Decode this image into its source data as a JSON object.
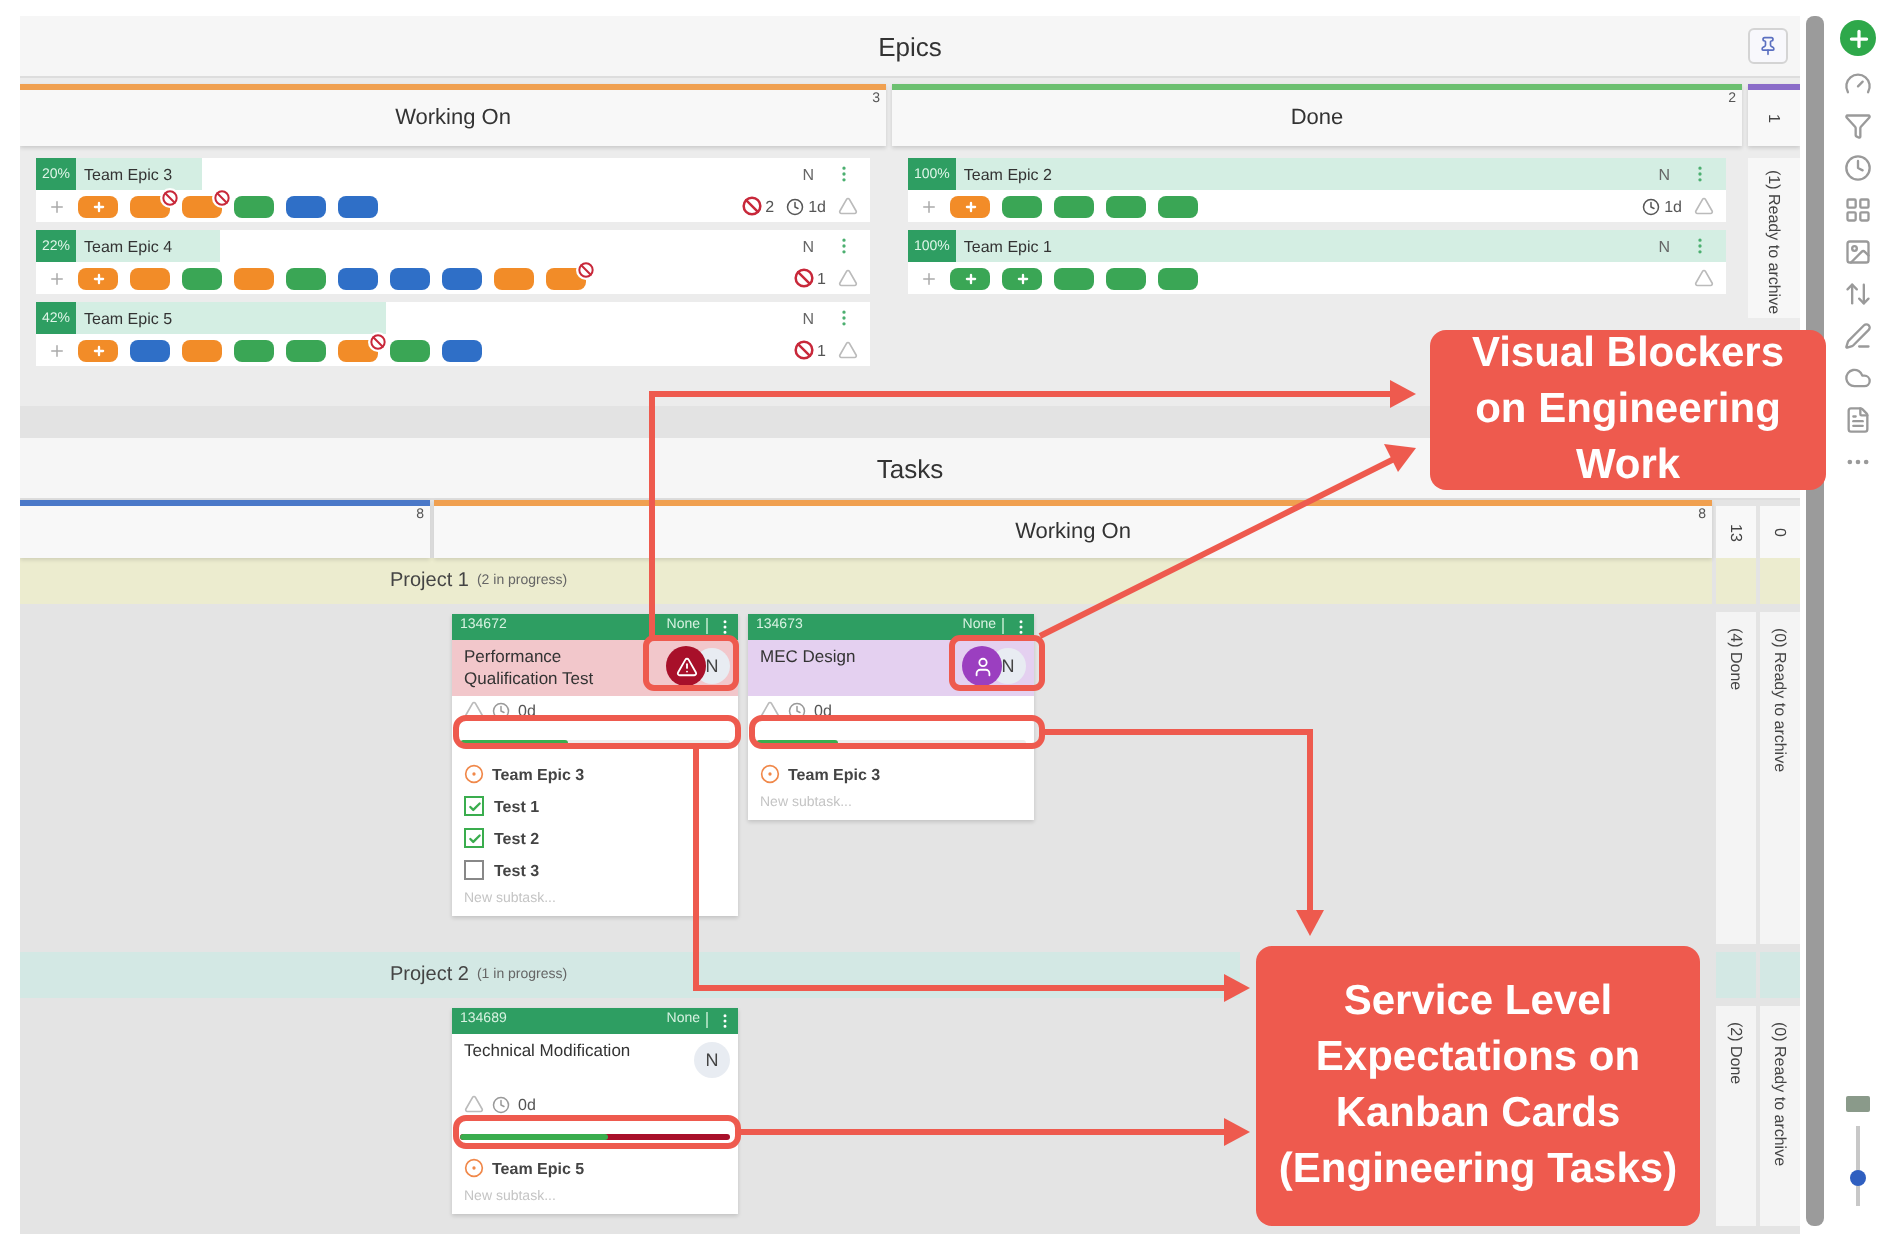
{
  "epics": {
    "title": "Epics",
    "columns": [
      {
        "title": "Working On",
        "count": "3",
        "color": "#f0a050",
        "cards": [
          {
            "percent": "20%",
            "level": 0.2,
            "name": "Team Epic 3",
            "avatar": "N",
            "chips": [
              {
                "color": "#f28c28",
                "kind": "plus"
              },
              {
                "color": "#f28c28",
                "kind": "blocked"
              },
              {
                "color": "#f28c28",
                "kind": "blocked"
              },
              {
                "color": "#3aa655",
                "kind": "plain"
              },
              {
                "color": "#2f6fc7",
                "kind": "plain"
              },
              {
                "color": "#2f6fc7",
                "kind": "plain"
              }
            ],
            "blockers": "2",
            "age": "1d"
          },
          {
            "percent": "22%",
            "level": 0.22,
            "name": "Team Epic 4",
            "avatar": "N",
            "chips": [
              {
                "color": "#f28c28",
                "kind": "plus"
              },
              {
                "color": "#f28c28",
                "kind": "plain"
              },
              {
                "color": "#3aa655",
                "kind": "plain"
              },
              {
                "color": "#f28c28",
                "kind": "plain"
              },
              {
                "color": "#3aa655",
                "kind": "plain"
              },
              {
                "color": "#2f6fc7",
                "kind": "plain"
              },
              {
                "color": "#2f6fc7",
                "kind": "plain"
              },
              {
                "color": "#2f6fc7",
                "kind": "plain"
              },
              {
                "color": "#f28c28",
                "kind": "plain"
              },
              {
                "color": "#f28c28",
                "kind": "blocked"
              }
            ],
            "blockers": "1"
          },
          {
            "percent": "42%",
            "level": 0.42,
            "name": "Team Epic 5",
            "avatar": "N",
            "chips": [
              {
                "color": "#f28c28",
                "kind": "plus"
              },
              {
                "color": "#2f6fc7",
                "kind": "plain"
              },
              {
                "color": "#f28c28",
                "kind": "plain"
              },
              {
                "color": "#3aa655",
                "kind": "plain"
              },
              {
                "color": "#3aa655",
                "kind": "plain"
              },
              {
                "color": "#f28c28",
                "kind": "blocked"
              },
              {
                "color": "#3aa655",
                "kind": "plain"
              },
              {
                "color": "#2f6fc7",
                "kind": "plain"
              }
            ],
            "blockers": "1"
          }
        ]
      },
      {
        "title": "Done",
        "count": "2",
        "color": "#6cc070",
        "cards": [
          {
            "percent": "100%",
            "level": 1,
            "name": "Team Epic 2",
            "avatar": "N",
            "chips": [
              {
                "color": "#f28c28",
                "kind": "plus"
              },
              {
                "color": "#3aa655",
                "kind": "plain"
              },
              {
                "color": "#3aa655",
                "kind": "plain"
              },
              {
                "color": "#3aa655",
                "kind": "plain"
              },
              {
                "color": "#3aa655",
                "kind": "plain"
              }
            ],
            "age": "1d"
          },
          {
            "percent": "100%",
            "level": 1,
            "name": "Team Epic 1",
            "avatar": "N",
            "chips": [
              {
                "color": "#3aa655",
                "kind": "plus"
              },
              {
                "color": "#3aa655",
                "kind": "plus"
              },
              {
                "color": "#3aa655",
                "kind": "plain"
              },
              {
                "color": "#3aa655",
                "kind": "plain"
              },
              {
                "color": "#3aa655",
                "kind": "plain"
              }
            ]
          }
        ]
      }
    ],
    "side": {
      "count": "1",
      "color": "#8a6cc8",
      "label": "(1) Ready to archive"
    }
  },
  "tasks": {
    "title": "Tasks",
    "columns": [
      {
        "count": "8",
        "color": "#4a78c8"
      },
      {
        "title": "Working On",
        "count": "8",
        "color": "#f0a050"
      }
    ],
    "side_columns": [
      {
        "count": "13"
      },
      {
        "count": "0"
      }
    ],
    "lanes": [
      {
        "title": "Project 1",
        "note": "(2 in progress)",
        "color": "#ececcf",
        "side": [
          "(4) Done",
          "(0) Ready to archive"
        ],
        "cards": [
          {
            "id": "134672",
            "class": "None",
            "title": "Performance Qualification Test",
            "color": "#f2c7cb",
            "avatar": "N",
            "kind": "blocked",
            "age": "0d",
            "level": 0.4,
            "sle_exceeded": false,
            "epic": "Team Epic 3",
            "subtasks": [
              {
                "label": "Test 1",
                "checked": true
              },
              {
                "label": "Test 2",
                "checked": true
              },
              {
                "label": "Test 3",
                "checked": false
              }
            ],
            "placeholder": "New subtask..."
          },
          {
            "id": "134673",
            "class": "None",
            "title": "MEC Design",
            "color": "#e4d0f0",
            "avatar": "N",
            "kind": "person",
            "age": "0d",
            "level": 0.3,
            "sle_exceeded": false,
            "epic": "Team Epic 3",
            "placeholder": "New subtask..."
          }
        ]
      },
      {
        "title": "Project 2",
        "note": "(1 in progress)",
        "color": "#d3e8e4",
        "side": [
          "(2) Done",
          "(0) Ready to archive"
        ],
        "cards": [
          {
            "id": "134689",
            "class": "None",
            "title": "Technical Modification",
            "color": "#ffffff",
            "avatar": "N",
            "kind": "plain",
            "age": "0d",
            "level": 0.55,
            "sle_exceeded": true,
            "epic": "Team Epic 5",
            "placeholder": "New subtask..."
          }
        ]
      }
    ]
  },
  "zoom_slider": {
    "level": 0.35
  },
  "callouts": [
    {
      "text": "Visual Blockers on Engineering Work"
    },
    {
      "text": "Service Level Expectations on Kanban Cards (Engineering Tasks)"
    }
  ]
}
